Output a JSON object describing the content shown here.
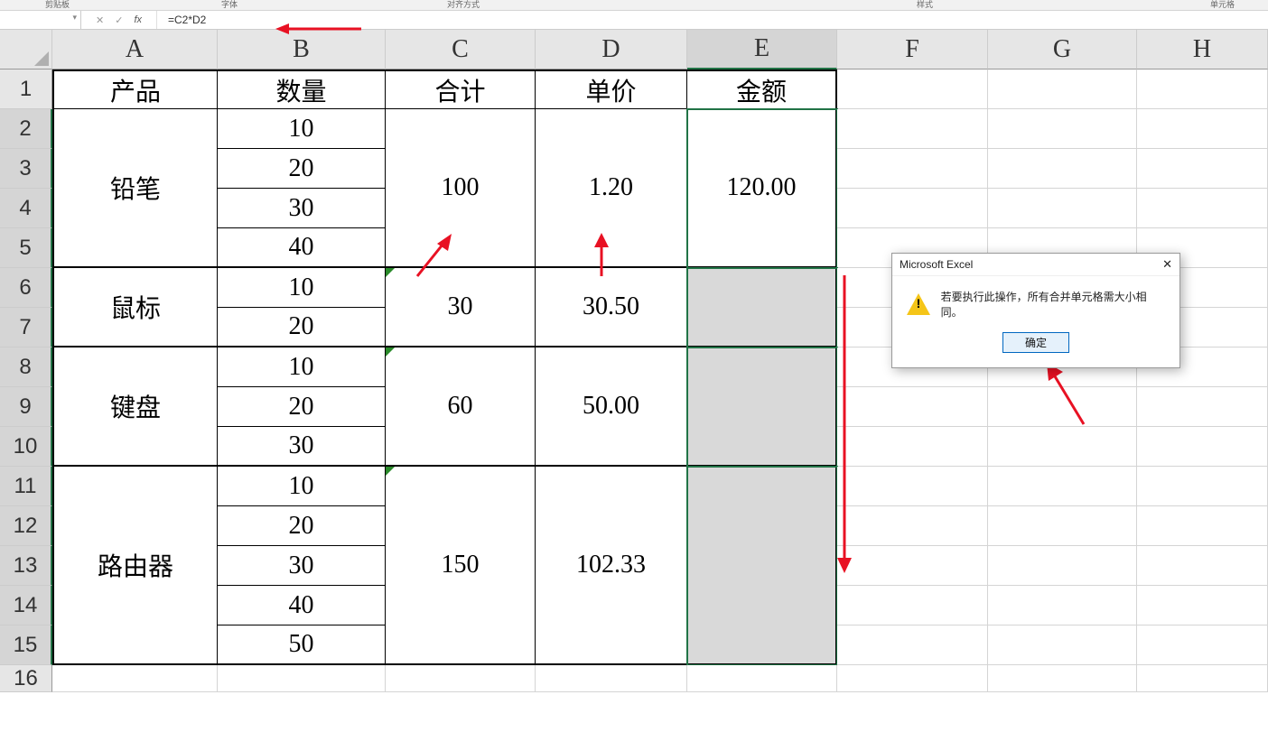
{
  "ribbon": {
    "g1": "剪贴板",
    "g2": "字体",
    "g3": "对齐方式",
    "g4": "样式",
    "g5": "单元格"
  },
  "namebox": "",
  "fb": {
    "cancel": "✕",
    "enter": "✓",
    "fx": "fx"
  },
  "formula": "=C2*D2",
  "cols": [
    "A",
    "B",
    "C",
    "D",
    "E",
    "F",
    "G",
    "H"
  ],
  "rows": [
    "1",
    "2",
    "3",
    "4",
    "5",
    "6",
    "7",
    "8",
    "9",
    "10",
    "11",
    "12",
    "13",
    "14",
    "15",
    "16"
  ],
  "headers": {
    "A": "产品",
    "B": "数量",
    "C": "合计",
    "D": "单价",
    "E": "金额"
  },
  "products": {
    "p1": "铅笔",
    "p2": "鼠标",
    "p3": "键盘",
    "p4": "路由器"
  },
  "qty": {
    "r2": "10",
    "r3": "20",
    "r4": "30",
    "r5": "40",
    "r6": "10",
    "r7": "20",
    "r8": "10",
    "r9": "20",
    "r10": "30",
    "r11": "10",
    "r12": "20",
    "r13": "30",
    "r14": "40",
    "r15": "50"
  },
  "totals": {
    "g1": "100",
    "g2": "30",
    "g3": "60",
    "g4": "150"
  },
  "price": {
    "g1": "1.20",
    "g2": "30.50",
    "g3": "50.00",
    "g4": "102.33"
  },
  "amount": {
    "g1": "120.00"
  },
  "dialog": {
    "title": "Microsoft Excel",
    "msg": "若要执行此操作，所有合并单元格需大小相同。",
    "ok": "确定"
  }
}
